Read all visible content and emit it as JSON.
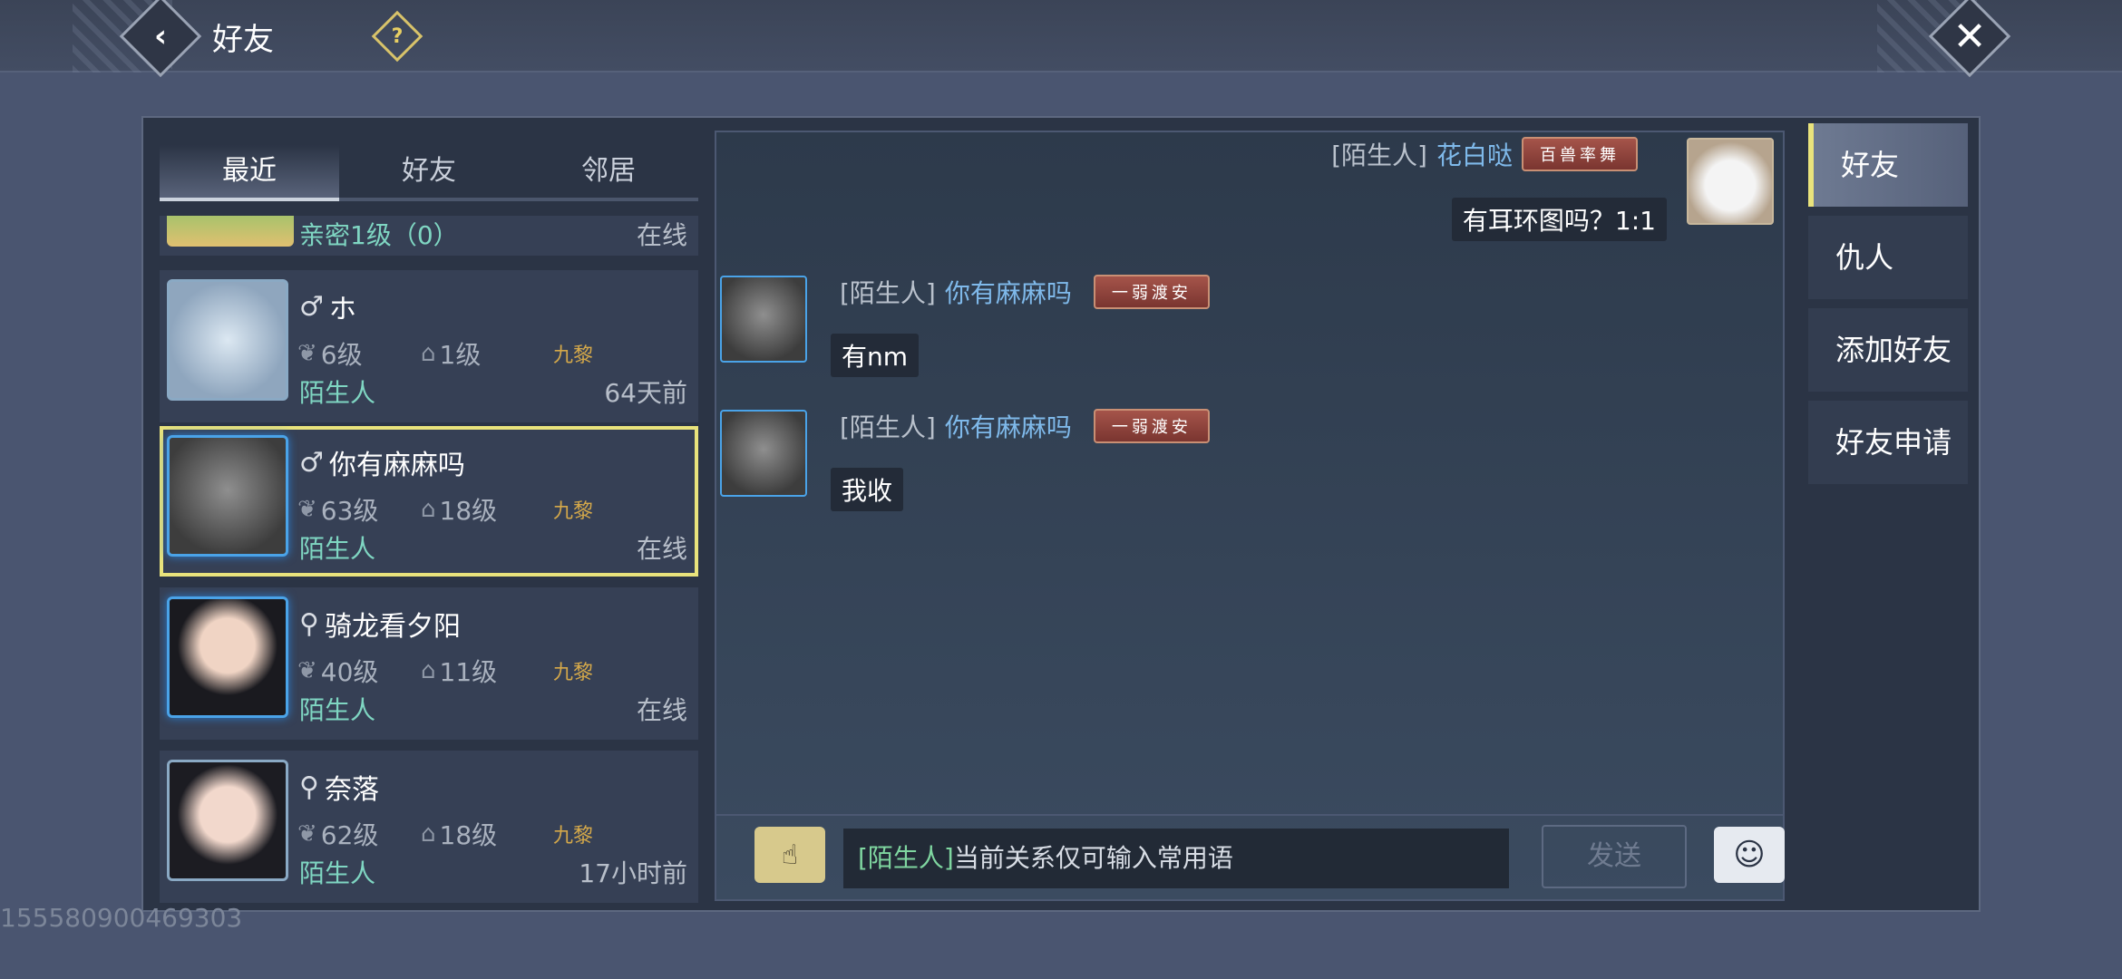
{
  "header": {
    "title": "好友",
    "back_icon": "‹",
    "help_icon": "?",
    "close_icon": "✕"
  },
  "tabs": [
    "最近",
    "好友",
    "邻居"
  ],
  "friends": [
    {
      "name": "",
      "relation": "亲密1级（0）",
      "status": "在线"
    },
    {
      "gender": "♂",
      "name": "ホ",
      "level": "6级",
      "home_level": "1级",
      "server": "九黎",
      "relation": "陌生人",
      "status": "64天前"
    },
    {
      "gender": "♂",
      "name": "你有麻麻吗",
      "level": "63级",
      "home_level": "18级",
      "server": "九黎",
      "relation": "陌生人",
      "status": "在线"
    },
    {
      "gender": "⚲",
      "name": "骑龙看夕阳",
      "level": "40级",
      "home_level": "11级",
      "server": "九黎",
      "relation": "陌生人",
      "status": "在线"
    },
    {
      "gender": "⚲",
      "name": "奈落",
      "level": "62级",
      "home_level": "18级",
      "server": "九黎",
      "relation": "陌生人",
      "status": "17小时前"
    }
  ],
  "chat": {
    "messages": [
      {
        "tag": "[陌生人]",
        "name": "花白哒",
        "badge": "百兽率舞",
        "text": "有耳环图吗？1:1"
      },
      {
        "tag": "[陌生人]",
        "name": "你有麻麻吗",
        "badge": "一弱渡安",
        "text": "有nm"
      },
      {
        "tag": "[陌生人]",
        "name": "你有麻麻吗",
        "badge": "一弱渡安",
        "text": "我收"
      }
    ],
    "input_tag": "[陌生人]",
    "input_text": "当前关系仅可输入常用语",
    "send_label": "发送",
    "quick_icon": "☝",
    "emoji_icon": "☺"
  },
  "side_tabs": [
    "好友",
    "仇人",
    "添加好友",
    "好友申请"
  ],
  "watermark": "155580900469303",
  "colors": {
    "accent_yellow": "#e9e37c",
    "relation_green": "#7fd6c2",
    "name_blue": "#7fb9ea",
    "server_gold": "#d4a84a"
  }
}
